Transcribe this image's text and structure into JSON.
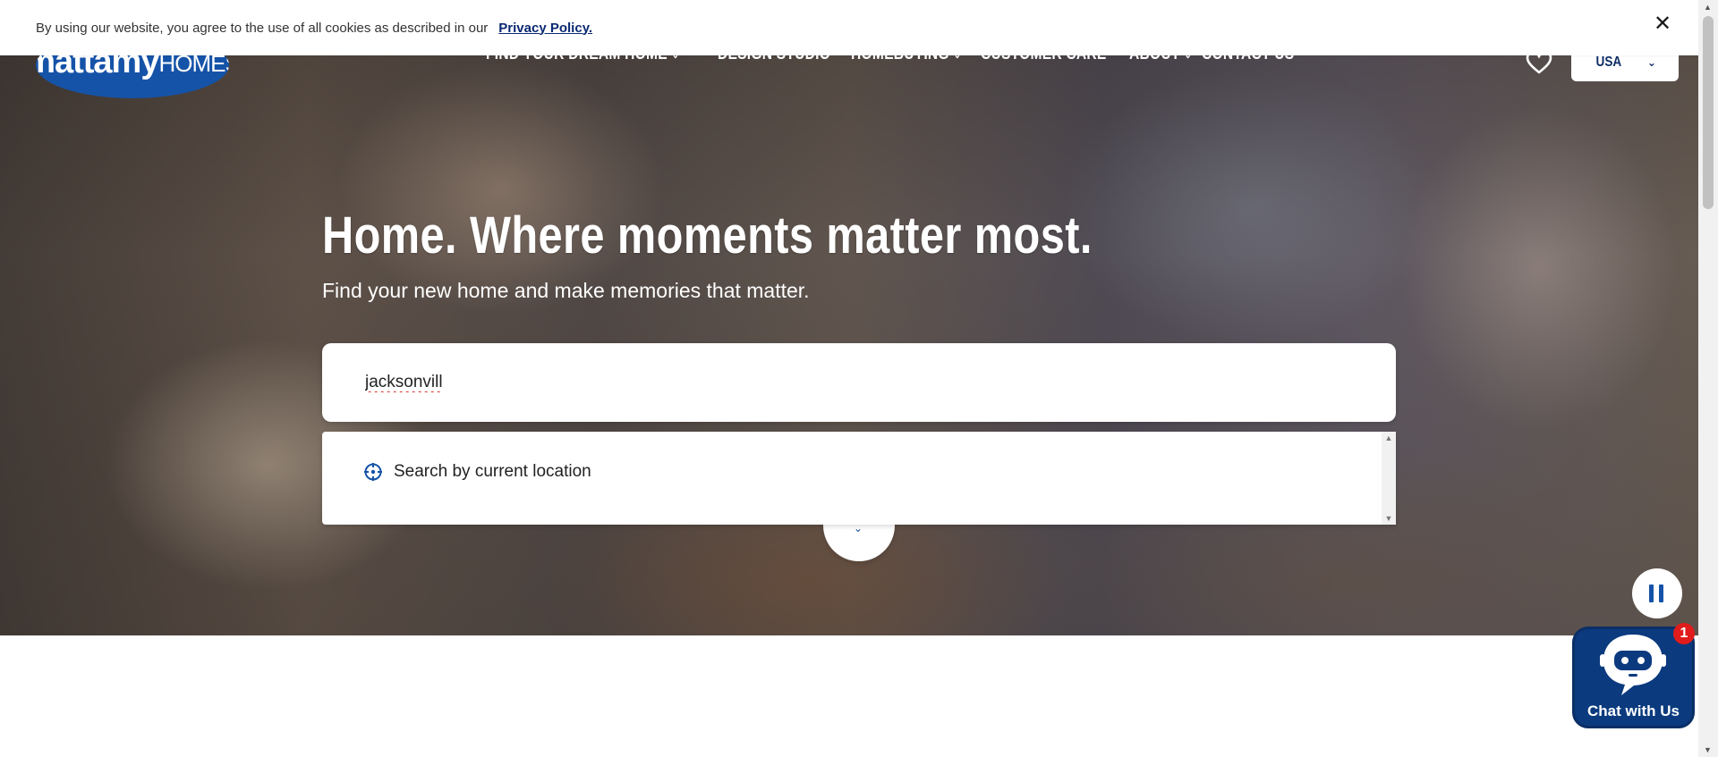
{
  "cookie_bar": {
    "text": "By using our website, you agree to the use of all cookies as described in our",
    "link": "Privacy Policy.",
    "close_icon": "close-icon"
  },
  "brand": {
    "logo_line1": "mattamy",
    "logo_line2": "HOMES",
    "color": "#1553a8"
  },
  "nav": {
    "items": [
      {
        "label": "FIND YOUR DREAM HOME",
        "has_dropdown": true
      },
      {
        "label": "DESIGN STUDIO",
        "has_dropdown": false
      },
      {
        "label": "HOMEBUYING",
        "has_dropdown": true
      },
      {
        "label": "CUSTOMER CARE",
        "has_dropdown": false
      },
      {
        "label": "ABOUT",
        "has_dropdown": true
      },
      {
        "label": "CONTACT US",
        "has_dropdown": false
      }
    ],
    "favorites_icon": "heart-icon",
    "country_selector": {
      "value": "USA",
      "icon": "chevron-down-icon"
    }
  },
  "hero": {
    "headline": "Home. Where moments matter most.",
    "subhead": "Find your new home and make memories that matter."
  },
  "search": {
    "value": "jacksonvill",
    "placeholder": "",
    "dropdown": {
      "option_label": "Search by current location",
      "option_icon": "crosshair-icon"
    }
  },
  "video_control": {
    "icon": "pause-icon"
  },
  "chat": {
    "label": "Chat with Us",
    "badge": "1",
    "icon": "chatbot-icon"
  },
  "colors": {
    "accent": "#1553a8",
    "nav_text": "#ffffff",
    "chat_bg": "#0b3a7e",
    "badge": "#e21b1b"
  }
}
